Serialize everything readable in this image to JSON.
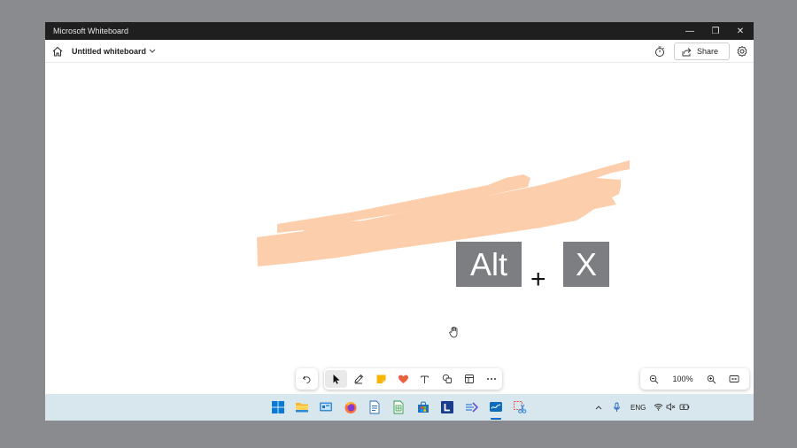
{
  "window": {
    "title": "Microsoft Whiteboard",
    "minimize_glyph": "—",
    "restore_glyph": "❐",
    "close_glyph": "✕"
  },
  "appbar": {
    "board_title": "Untitled whiteboard",
    "share_label": "Share",
    "icons": [
      "home-icon",
      "chevron-down-icon",
      "timer-icon",
      "share-icon",
      "gear-icon"
    ]
  },
  "canvas": {
    "stroke_color": "#fdceab",
    "shortcut": {
      "key1": "Alt",
      "plus": "+",
      "key2": "X",
      "key_color": "#7d7e82"
    }
  },
  "toolbar": {
    "tools": [
      "undo-icon",
      "select-arrow-icon",
      "pen-icon",
      "sticky-note-icon",
      "reaction-heart-icon",
      "text-icon",
      "shapes-icon",
      "template-icon",
      "more-icon"
    ],
    "active_tool": "select-arrow-icon",
    "zoom_level": "100%"
  },
  "taskbar": {
    "apps": [
      "windows-start-icon",
      "file-explorer-icon",
      "control-panel-icon",
      "firefox-icon",
      "writer-icon",
      "calc-icon",
      "store-icon",
      "l-app-icon",
      "arrow-app-icon",
      "whiteboard-icon",
      "snipping-tool-icon"
    ],
    "language": "ENG",
    "colors": {
      "accent": "#0067c0",
      "taskbar_bg": "#d8e6ee"
    }
  }
}
